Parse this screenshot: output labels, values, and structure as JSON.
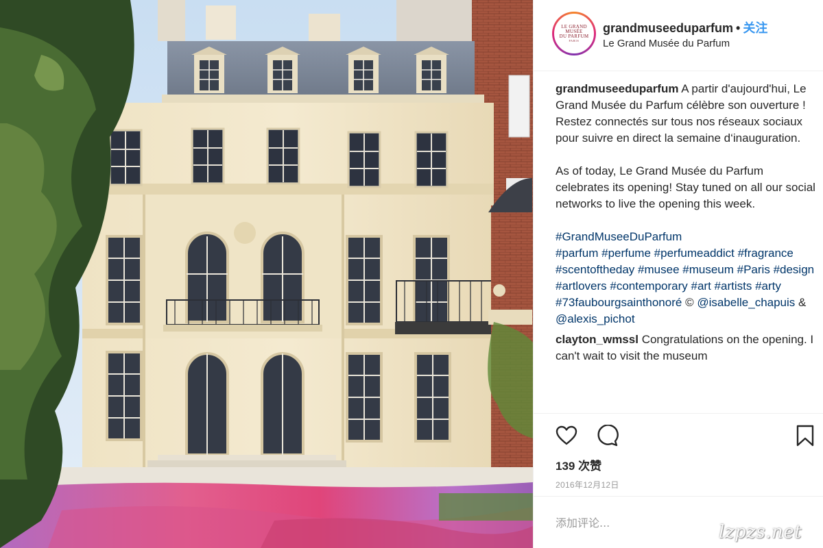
{
  "post": {
    "image_description_icon": "building-photo",
    "header": {
      "avatar_text": [
        "LE GRAND",
        "MUSÉE",
        "DU PARFUM",
        "PARIS"
      ],
      "username": "grandmuseeduparfum",
      "separator": "•",
      "follow_label": "关注",
      "location": "Le Grand Musée du Parfum"
    },
    "caption": {
      "username": "grandmuseeduparfum",
      "text_fr": "A partir d'aujourd'hui, Le Grand Musée du Parfum célèbre son ouverture ! Restez connectés sur tous nos réseaux sociaux pour suivre en direct la semaine d‘inauguration.",
      "text_en": "As of today, Le Grand Musée du Parfum celebrates its opening! Stay tuned on all our social networks to live the opening this week.",
      "hashtags": [
        "#GrandMuseeDuParfum",
        "#parfum",
        "#perfume",
        "#perfumeaddict",
        "#fragrance",
        "#scentoftheday",
        "#musee",
        "#museum",
        "#Paris",
        "#design",
        "#artlovers",
        "#contemporary",
        "#art",
        "#artists",
        "#arty",
        "#73faubourgsainthonoré"
      ],
      "credit_symbol": "©",
      "mention_1": "@isabelle_chapuis",
      "credit_joiner": "&",
      "mention_2": "@alexis_pichot"
    },
    "comments": [
      {
        "username": "clayton_wmssl",
        "text": "Congratulations on the opening. I can't wait to visit the museum"
      }
    ],
    "actions": {
      "like_icon": "heart-icon",
      "comment_icon": "comment-bubble-icon",
      "save_icon": "bookmark-icon"
    },
    "likes_label": "139 次赞",
    "date": "2016年12月12日",
    "add_comment_placeholder": "添加评论..."
  },
  "watermark": "lzpzs.net",
  "colors": {
    "link": "#003569",
    "follow": "#3897f0",
    "text": "#262626",
    "muted": "#999999"
  }
}
